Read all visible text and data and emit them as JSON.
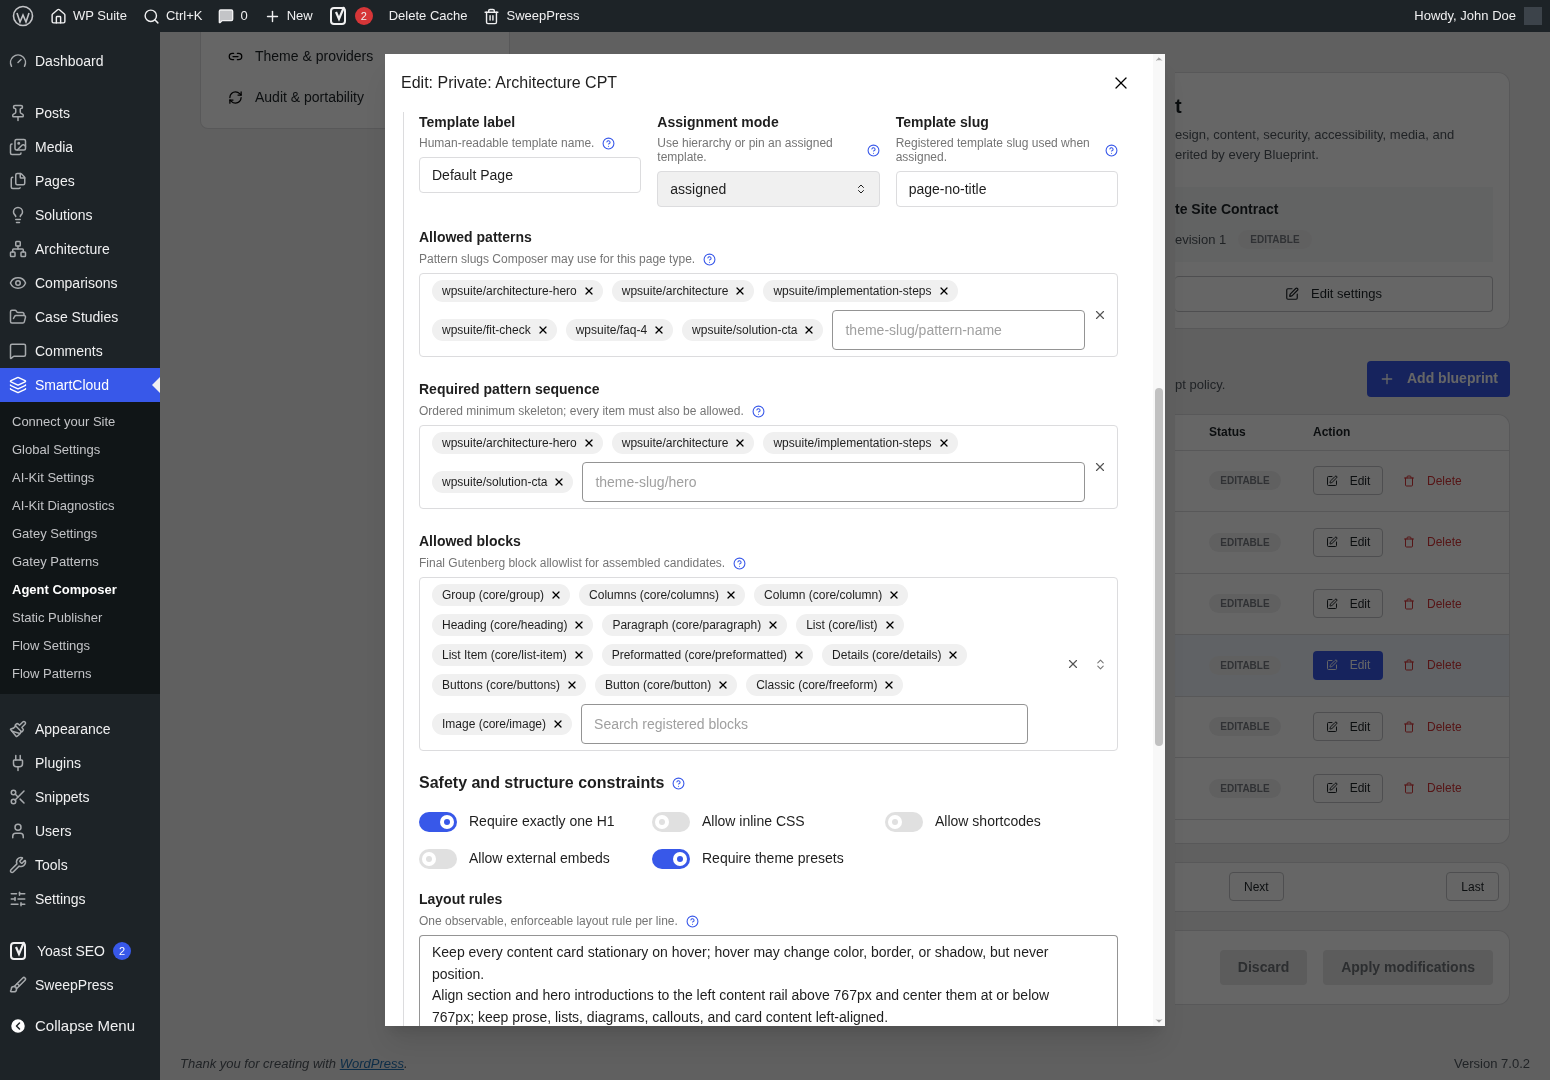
{
  "admin_bar": {
    "site": "WP Suite",
    "search": "Ctrl+K",
    "comments": "0",
    "new": "New",
    "yoast_badge": "2",
    "cache": "Delete Cache",
    "sweeppress": "SweepPress",
    "greeting": "Howdy, John Doe"
  },
  "sidebar": {
    "groups": [
      [
        {
          "label": "Dashboard",
          "selected": false
        }
      ],
      [
        {
          "label": "Posts",
          "selected": false
        },
        {
          "label": "Media",
          "selected": false
        },
        {
          "label": "Pages",
          "selected": false
        },
        {
          "label": "Solutions",
          "selected": false
        },
        {
          "label": "Architecture",
          "selected": false
        },
        {
          "label": "Comparisons",
          "selected": false
        },
        {
          "label": "Case Studies",
          "selected": false
        },
        {
          "label": "Comments",
          "selected": false
        },
        {
          "label": "SmartCloud",
          "selected": true,
          "children": [
            {
              "label": "Connect your Site",
              "selected": false
            },
            {
              "label": "Global Settings",
              "selected": false
            },
            {
              "label": "AI-Kit Settings",
              "selected": false
            },
            {
              "label": "AI-Kit Diagnostics",
              "selected": false
            },
            {
              "label": "Gatey Settings",
              "selected": false
            },
            {
              "label": "Gatey Patterns",
              "selected": false
            },
            {
              "label": "Agent Composer",
              "selected": true
            },
            {
              "label": "Static Publisher",
              "selected": false
            },
            {
              "label": "Flow Settings",
              "selected": false
            },
            {
              "label": "Flow Patterns",
              "selected": false
            }
          ]
        }
      ],
      [
        {
          "label": "Appearance",
          "selected": false
        },
        {
          "label": "Plugins",
          "selected": false
        },
        {
          "label": "Snippets",
          "selected": false
        },
        {
          "label": "Users",
          "selected": false
        },
        {
          "label": "Tools",
          "selected": false
        },
        {
          "label": "Settings",
          "selected": false
        }
      ],
      [
        {
          "label": "Yoast SEO",
          "selected": false,
          "badge": "2"
        },
        {
          "label": "SweepPress",
          "selected": false
        }
      ]
    ],
    "collapse": "Collapse Menu"
  },
  "background": {
    "left_links": [
      "Theme & providers",
      "Audit & portability"
    ],
    "heading": "t",
    "description": "esign, content, security, accessibility, media, and erited by every Blueprint.",
    "contract": {
      "title": "te Site Contract",
      "revision": "evision 1",
      "badge": "EDITABLE"
    },
    "edit_settings": "Edit settings",
    "policy": "pt policy.",
    "add_button": "Add blueprint",
    "table": {
      "columns": [
        "Status",
        "Action"
      ],
      "rows": [
        {
          "status": "EDITABLE",
          "edit": "Edit",
          "delete": "Delete",
          "selected": false
        },
        {
          "status": "EDITABLE",
          "edit": "Edit",
          "delete": "Delete",
          "selected": false
        },
        {
          "status": "EDITABLE",
          "edit": "Edit",
          "delete": "Delete",
          "selected": false
        },
        {
          "status": "EDITABLE",
          "edit": "Edit",
          "delete": "Delete",
          "selected": true
        },
        {
          "status": "EDITABLE",
          "edit": "Edit",
          "delete": "Delete",
          "selected": false
        },
        {
          "status": "EDITABLE",
          "edit": "Edit",
          "delete": "Delete",
          "selected": false
        }
      ]
    },
    "pagination": [
      "Next",
      "Last"
    ],
    "actions": [
      {
        "label": "Discard",
        "disabled": true
      },
      {
        "label": "Apply modifications",
        "disabled": true
      }
    ],
    "footer": {
      "text": "Thank you for creating with ",
      "link": "WordPress",
      "end": "."
    },
    "version": "Version 7.0.2"
  },
  "modal": {
    "title": "Edit: Private: Architecture CPT",
    "fields": [
      {
        "kind": "text",
        "label": "Template label",
        "help": "Human-readable template name.",
        "value": "Default Page"
      },
      {
        "kind": "select",
        "label": "Assignment mode",
        "help": "Use hierarchy or pin an assigned template.",
        "value": "assigned"
      },
      {
        "kind": "text",
        "label": "Template slug",
        "help": "Registered template slug used when assigned.",
        "value": "page-no-title"
      }
    ],
    "tag_sections": [
      {
        "label": "Allowed patterns",
        "help": "Pattern slugs Composer may use for this page type.",
        "tags": [
          "wpsuite/architecture-hero",
          "wpsuite/architecture",
          "wpsuite/implementation-steps",
          "wpsuite/fit-check",
          "wpsuite/faq-4",
          "wpsuite/solution-cta"
        ],
        "placeholder": "theme-slug/pattern-name",
        "kind": "tags"
      },
      {
        "label": "Required pattern sequence",
        "help": "Ordered minimum skeleton; every item must also be allowed.",
        "tags": [
          "wpsuite/architecture-hero",
          "wpsuite/architecture",
          "wpsuite/implementation-steps",
          "wpsuite/solution-cta"
        ],
        "placeholder": "theme-slug/hero",
        "kind": "tags"
      },
      {
        "label": "Allowed blocks",
        "help": "Final Gutenberg block allowlist for assembled candidates.",
        "tags": [
          "Group (core/group)",
          "Columns (core/columns)",
          "Column (core/column)",
          "Heading (core/heading)",
          "Paragraph (core/paragraph)",
          "List (core/list)",
          "List Item (core/list-item)",
          "Preformatted (core/preformatted)",
          "Details (core/details)",
          "Buttons (core/buttons)",
          "Button (core/button)",
          "Classic (core/freeform)",
          "Image (core/image)"
        ],
        "placeholder": "Search registered blocks",
        "kind": "combobox"
      }
    ],
    "constraints": {
      "title": "Safety and structure constraints",
      "toggles": [
        {
          "label": "Require exactly one H1",
          "on": true
        },
        {
          "label": "Allow inline CSS",
          "on": false
        },
        {
          "label": "Allow shortcodes",
          "on": false
        },
        {
          "label": "Allow external embeds",
          "on": false
        },
        {
          "label": "Require theme presets",
          "on": true
        }
      ]
    },
    "layout_rules": {
      "label": "Layout rules",
      "help": "One observable, enforceable layout rule per line.",
      "value": "Keep every content card stationary on hover; hover may change color, border, or shadow, but never position.\nAlign section and hero introductions to the left content rail above 767px and center them at or below 767px; keep prose, lists, diagrams, callouts, and card content left-aligned."
    }
  }
}
